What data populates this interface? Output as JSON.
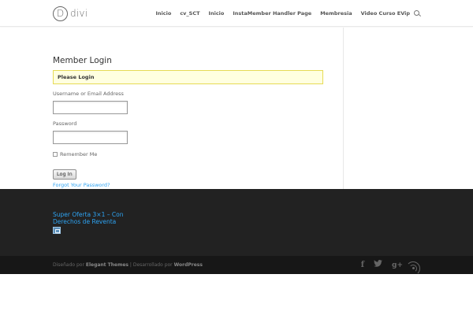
{
  "header": {
    "logo_text": "divi",
    "nav": [
      "Inicio",
      "cv_SCT",
      "Inicio",
      "InstaMember Handler Page",
      "Membresia",
      "Video Curso EVip"
    ]
  },
  "main": {
    "title": "Member Login",
    "notice": "Please Login",
    "username_label": "Username or Email Address",
    "username_value": "",
    "password_label": "Password",
    "password_value": "",
    "remember_label": "Remember Me",
    "login_button": "Log In",
    "forgot_link": "Forgot Your Password?"
  },
  "footer_widget": {
    "link_text": "Super Oferta 3×1 – Con Derechos de Reventa"
  },
  "bottom_bar": {
    "credits_prefix": "Diseñado por",
    "credits_theme": "Elegant Themes",
    "credits_middle": "| Desarrollado por",
    "credits_platform": "WordPress",
    "social_icons": [
      "facebook-icon",
      "twitter-icon",
      "google-plus-icon",
      "rss-icon"
    ],
    "facebook_glyph": "f",
    "twitter_glyph": "🐦",
    "gplus_glyph": "g+"
  },
  "colors": {
    "accent": "#2ea3f2",
    "footer_bg": "#222222",
    "bottom_bar_bg": "#171717",
    "notice_bg": "#ffffe0",
    "notice_border": "#e6db55"
  }
}
